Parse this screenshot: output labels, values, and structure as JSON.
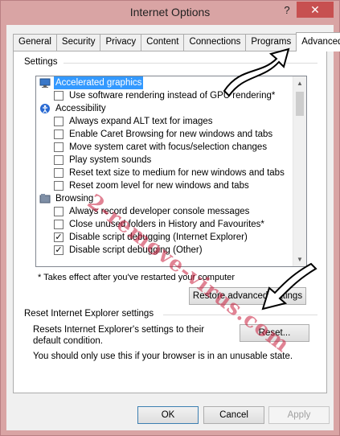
{
  "window": {
    "title": "Internet Options",
    "help_label": "?",
    "close_label": "✕"
  },
  "tabs": [
    {
      "label": "General",
      "active": false
    },
    {
      "label": "Security",
      "active": false
    },
    {
      "label": "Privacy",
      "active": false
    },
    {
      "label": "Content",
      "active": false
    },
    {
      "label": "Connections",
      "active": false
    },
    {
      "label": "Programs",
      "active": false
    },
    {
      "label": "Advanced",
      "active": true
    }
  ],
  "settings": {
    "label": "Settings",
    "rows": [
      {
        "kind": "category",
        "icon": "monitor-icon",
        "label": "Accelerated graphics",
        "selected": true
      },
      {
        "kind": "option",
        "label": "Use software rendering instead of GPU rendering*",
        "checked": false
      },
      {
        "kind": "category",
        "icon": "accessibility-icon",
        "label": "Accessibility",
        "selected": false
      },
      {
        "kind": "option",
        "label": "Always expand ALT text for images",
        "checked": false
      },
      {
        "kind": "option",
        "label": "Enable Caret Browsing for new windows and tabs",
        "checked": false
      },
      {
        "kind": "option",
        "label": "Move system caret with focus/selection changes",
        "checked": false
      },
      {
        "kind": "option",
        "label": "Play system sounds",
        "checked": false
      },
      {
        "kind": "option",
        "label": "Reset text size to medium for new windows and tabs",
        "checked": false
      },
      {
        "kind": "option",
        "label": "Reset zoom level for new windows and tabs",
        "checked": false
      },
      {
        "kind": "category",
        "icon": "folder-icon",
        "label": "Browsing",
        "selected": false
      },
      {
        "kind": "option",
        "label": "Always record developer console messages",
        "checked": false
      },
      {
        "kind": "option",
        "label": "Close unused folders in History and Favourites*",
        "checked": false
      },
      {
        "kind": "option",
        "label": "Disable script debugging (Internet Explorer)",
        "checked": true
      },
      {
        "kind": "option",
        "label": "Disable script debugging (Other)",
        "checked": true
      }
    ],
    "footnote": "* Takes effect after you've restarted your computer",
    "restore_label": "Restore advanced settings"
  },
  "reset_section": {
    "label": "Reset Internet Explorer settings",
    "description": "Resets Internet Explorer's settings to their default condition.",
    "reset_label": "Reset...",
    "warning": "You should only use this if your browser is in an unusable state."
  },
  "buttons": {
    "ok": "OK",
    "cancel": "Cancel",
    "apply": "Apply"
  },
  "watermark": "2-remove-virus.com",
  "colors": {
    "frame": "#d9a4a4",
    "close": "#c75050",
    "selection": "#3399ff",
    "watermark": "#c81e3c"
  }
}
